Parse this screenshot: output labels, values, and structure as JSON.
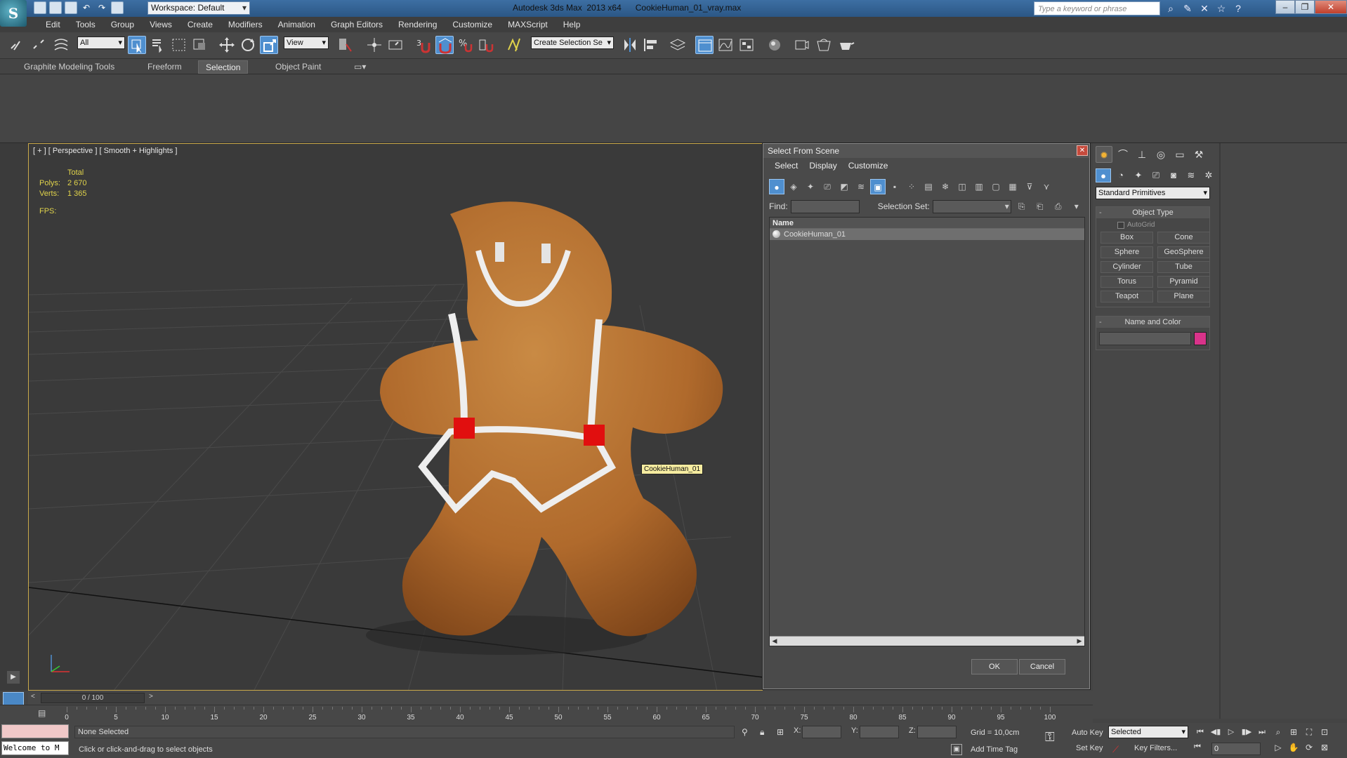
{
  "titlebar": {
    "app_logo": "S",
    "workspace": "Workspace: Default",
    "title": "Autodesk 3ds Max  2013 x64      CookieHuman_01_vray.max",
    "search_placeholder": "Type a keyword or phrase"
  },
  "menu": [
    "Edit",
    "Tools",
    "Group",
    "Views",
    "Create",
    "Modifiers",
    "Animation",
    "Graph Editors",
    "Rendering",
    "Customize",
    "MAXScript",
    "Help"
  ],
  "toolbar": {
    "filter_value": "All",
    "refcoord_value": "View",
    "selection_set_placeholder": "Create Selection Se"
  },
  "ribbon_tabs": [
    "Graphite Modeling Tools",
    "Freeform",
    "Selection",
    "Object Paint"
  ],
  "viewport": {
    "label": "[ + ] [ Perspective ] [ Smooth + Highlights ]",
    "stats_header": "Total",
    "polys_label": "Polys:",
    "polys_value": "2 670",
    "verts_label": "Verts:",
    "verts_value": "1 365",
    "fps_label": "FPS:",
    "tooltip": "CookieHuman_01"
  },
  "dialog": {
    "title": "Select From Scene",
    "menu": [
      "Select",
      "Display",
      "Customize"
    ],
    "find_label": "Find:",
    "selection_set_label": "Selection Set:",
    "column_name": "Name",
    "items": [
      "CookieHuman_01"
    ],
    "ok": "OK",
    "cancel": "Cancel"
  },
  "command_panel": {
    "primitive_type": "Standard Primitives",
    "object_type_header": "Object Type",
    "autogrid": "AutoGrid",
    "primitives": [
      "Box",
      "Cone",
      "Sphere",
      "GeoSphere",
      "Cylinder",
      "Tube",
      "Torus",
      "Pyramid",
      "Teapot",
      "Plane"
    ],
    "name_color_header": "Name and Color",
    "color": "#d9338a"
  },
  "timeline": {
    "slider": "0 / 100",
    "ticks": [
      "0",
      "5",
      "10",
      "15",
      "20",
      "25",
      "30",
      "35",
      "40",
      "45",
      "50",
      "55",
      "60",
      "65",
      "70",
      "75",
      "80",
      "85",
      "90",
      "95",
      "100"
    ]
  },
  "status": {
    "listener": "Welcome to M",
    "selection": "None Selected",
    "prompt": "Click or click-and-drag to select objects",
    "x_label": "X:",
    "y_label": "Y:",
    "z_label": "Z:",
    "grid": "Grid = 10,0cm",
    "add_time_tag": "Add Time Tag",
    "auto_key": "Auto Key",
    "set_key": "Set Key",
    "selected": "Selected",
    "key_filters": "Key Filters...",
    "frame": "0"
  }
}
